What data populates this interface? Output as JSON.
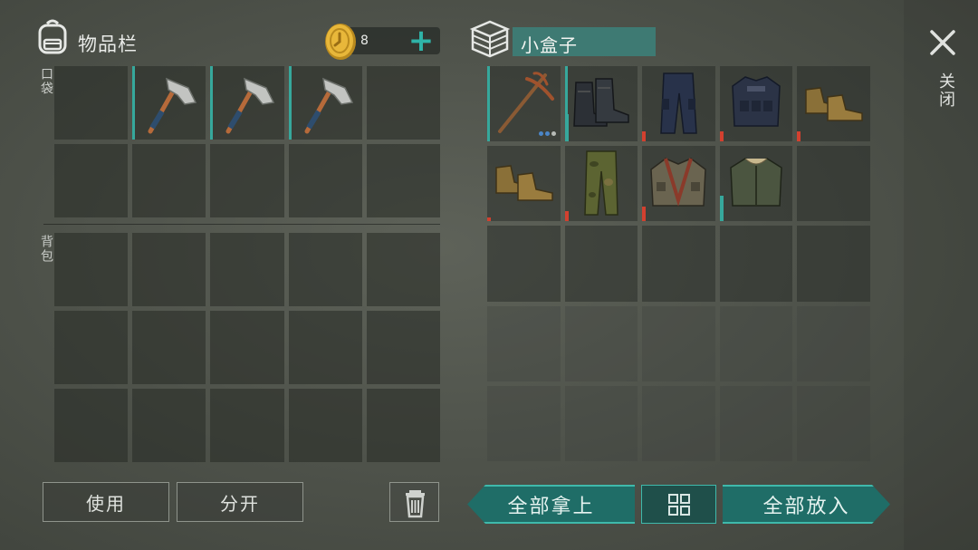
{
  "inventory": {
    "title": "物品栏",
    "pocket_label": "口袋",
    "backpack_label": "背包",
    "coins": "8"
  },
  "container": {
    "name": "小盒子"
  },
  "buttons": {
    "use": "使用",
    "split": "分开",
    "take_all": "全部拿上",
    "put_all": "全部放入"
  },
  "close": {
    "label": "关闭"
  },
  "pocket_items": [
    "",
    "hatchet",
    "hatchet",
    "hatchet",
    ""
  ],
  "container_items": [
    "pickaxe",
    "boots",
    "tactical-pants",
    "tactical-vest",
    "leather-shoes",
    "leather-shoes",
    "camo-pants",
    "survival-jacket",
    "bomber-jacket",
    ""
  ],
  "colors": {
    "accent": "#36a89c",
    "durability": "#d2402f",
    "panel_bg": "#50544c"
  }
}
